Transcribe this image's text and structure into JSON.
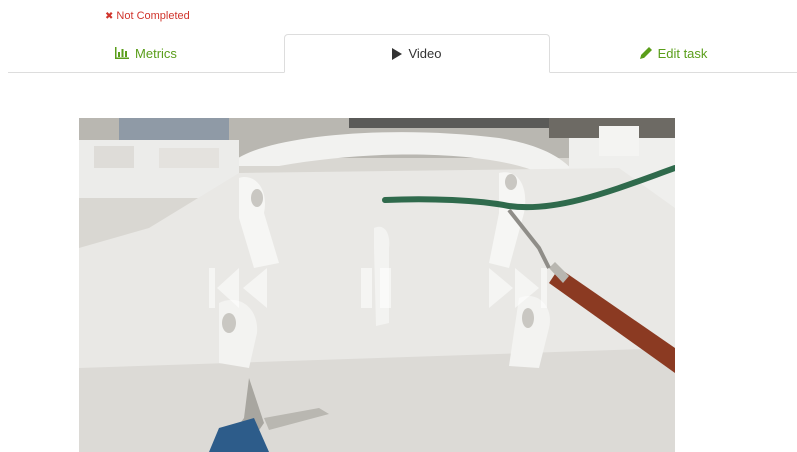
{
  "status": {
    "text": "Not Completed",
    "icon": "close-icon",
    "color": "#d0342c"
  },
  "tabs": {
    "metrics": {
      "label": "Metrics",
      "icon": "bar-chart-icon"
    },
    "video": {
      "label": "Video",
      "icon": "play-icon",
      "active": true
    },
    "edit": {
      "label": "Edit task",
      "icon": "pencil-icon"
    }
  },
  "colors": {
    "accent": "#5a9e1a",
    "error": "#d0342c"
  },
  "video": {
    "controls": [
      "skip-back-icon",
      "pause-icon",
      "skip-forward-icon"
    ]
  }
}
